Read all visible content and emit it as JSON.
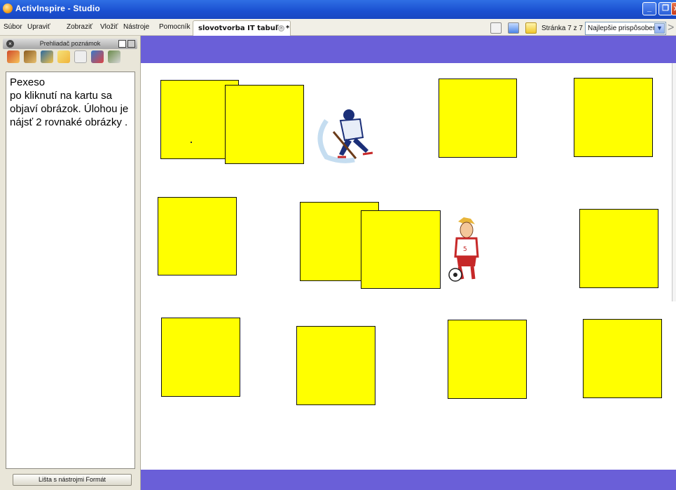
{
  "window": {
    "title": "ActivInspire - Studio"
  },
  "menu": {
    "items": [
      "Súbor",
      "Upraviť",
      "Zobraziť",
      "Vložiť",
      "Nástroje",
      "Pomocník"
    ]
  },
  "document_tab": {
    "label": "slovotvorba IT tabuľa *"
  },
  "toolbar": {
    "page_counter": "Stránka 7 z 7",
    "zoom_value": "Najlepšie prispôsobenie"
  },
  "notes_panel": {
    "title": "Prehliadač poznámok",
    "notes_text": "Pexeso\npo kliknutí na kartu sa objaví obrázok. Úlohou je nájsť 2 rovnaké obrázky .",
    "format_button": "Lišta s nástrojmi Formát"
  },
  "canvas": {
    "card_color": "#ffff00",
    "frame_color": "#6a5fd8",
    "card_count": 13,
    "revealed_images": [
      "hockey-player",
      "soccer-player"
    ]
  }
}
